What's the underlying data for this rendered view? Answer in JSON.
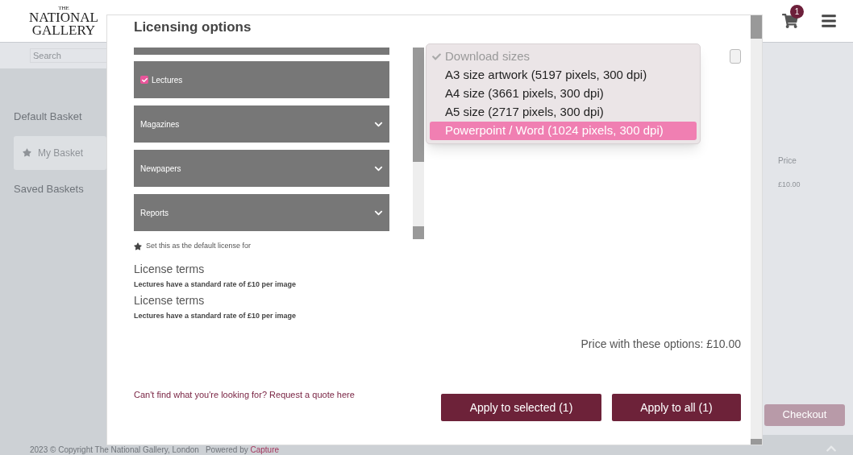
{
  "header": {
    "logo": [
      "THE",
      "NATIONAL",
      "GALLERY"
    ],
    "cart_badge": "1"
  },
  "search": {
    "placeholder": "Search"
  },
  "sidebar": {
    "heading": "Default Basket",
    "basket": "My Basket",
    "saved": "Saved Baskets"
  },
  "basket_table": {
    "column": "Price",
    "cell": "£10.00",
    "checkout": "Checkout"
  },
  "footer": {
    "copyright": "2023 © Copyright The National Gallery, London",
    "powered_by": "Powered by",
    "brand": "Capture"
  },
  "modal": {
    "title": "Licensing options",
    "categories": [
      {
        "label": "Lectures",
        "kind": "checkbox",
        "checked": true
      },
      {
        "label": "Magazines",
        "kind": "accordion",
        "expanded": false
      },
      {
        "label": "Newpapers",
        "kind": "accordion",
        "expanded": false
      },
      {
        "label": "Reports",
        "kind": "accordion",
        "expanded": false
      }
    ],
    "default_license": "Set this as the default license for",
    "terms": [
      {
        "heading": "License terms",
        "text": "Lectures have a standard rate of £10 per image"
      },
      {
        "heading": "License terms",
        "text": "Lectures have a standard rate of £10 per image"
      }
    ],
    "quote_link": "Can't find what you're looking for? Request a quote here",
    "dropdown": {
      "header": "Download sizes",
      "options": [
        {
          "label": "A3 size artwork (5197 pixels, 300 dpi)",
          "selected": false
        },
        {
          "label": "A4 size (3661 pixels, 300 dpi)",
          "selected": false
        },
        {
          "label": "A5 size (2717 pixels, 300 dpi)",
          "selected": false
        },
        {
          "label": "Powerpoint / Word (1024 pixels, 300 dpi)",
          "selected": true
        }
      ]
    },
    "price": "Price with these options: £10.00",
    "buttons": [
      "Apply to selected (1)",
      "Apply to all (1)"
    ]
  }
}
